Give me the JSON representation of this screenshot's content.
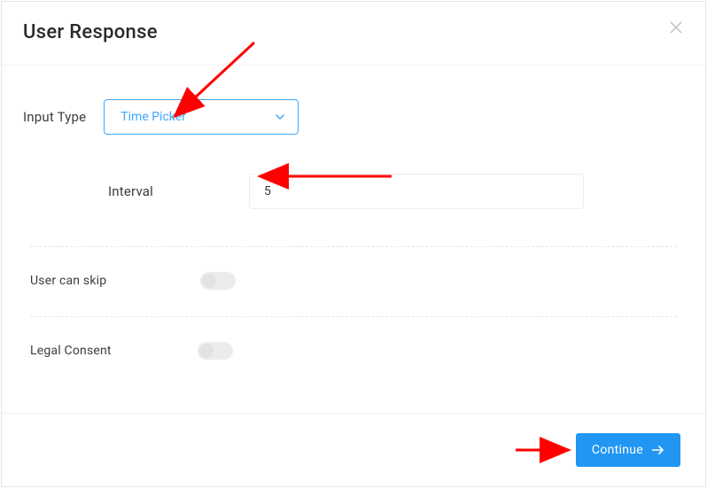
{
  "header": {
    "title": "User Response"
  },
  "form": {
    "input_type_label": "Input Type",
    "input_type_value": "Time Picker",
    "interval_label": "Interval",
    "interval_value": "5",
    "skip_label": "User can skip",
    "consent_label": "Legal Consent"
  },
  "footer": {
    "continue_label": "Continue"
  },
  "colors": {
    "accent": "#2196f3",
    "select_border": "#3ea8ff",
    "annotation": "#ff0000"
  }
}
